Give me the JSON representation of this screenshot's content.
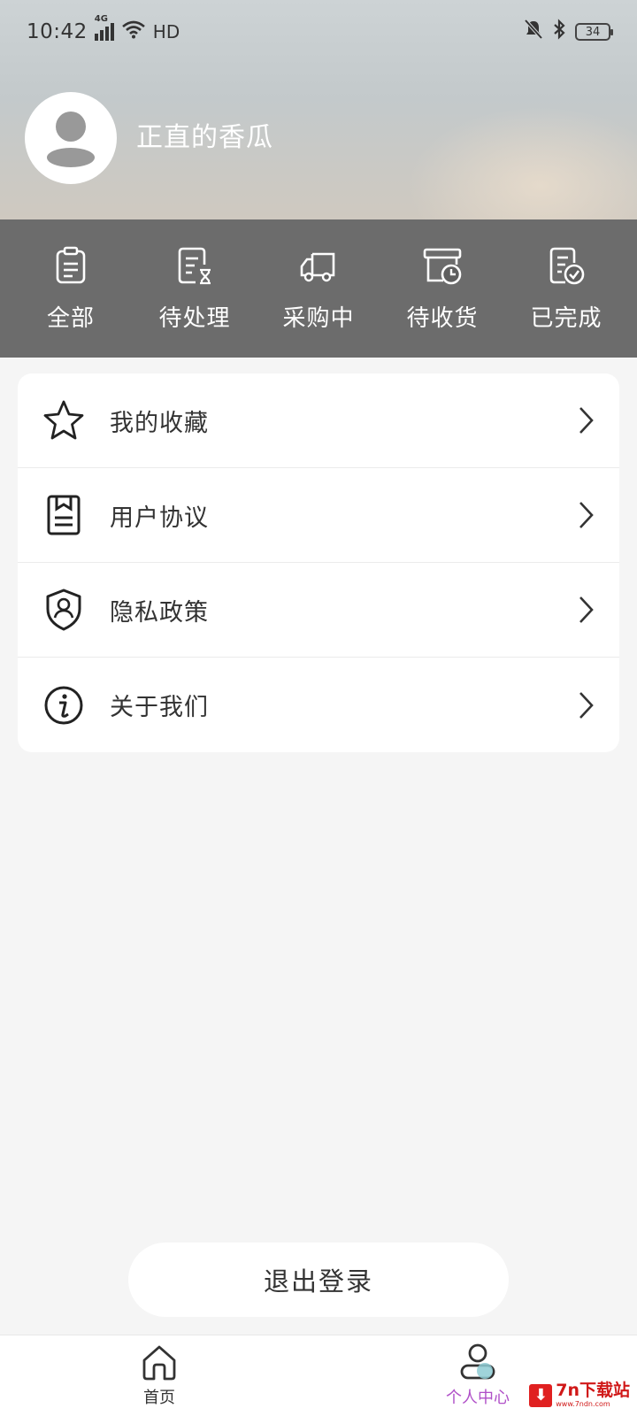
{
  "status_bar": {
    "time": "10:42",
    "network": "4G",
    "wifi_label": "HD",
    "battery": "34"
  },
  "profile": {
    "username": "正直的香瓜"
  },
  "orders": [
    {
      "label": "全部",
      "icon": "clipboard-icon"
    },
    {
      "label": "待处理",
      "icon": "pending-doc-icon"
    },
    {
      "label": "采购中",
      "icon": "truck-icon"
    },
    {
      "label": "待收货",
      "icon": "box-clock-icon"
    },
    {
      "label": "已完成",
      "icon": "doc-check-icon"
    }
  ],
  "menu": [
    {
      "label": "我的收藏",
      "icon": "star-icon"
    },
    {
      "label": "用户协议",
      "icon": "agreement-icon"
    },
    {
      "label": "隐私政策",
      "icon": "shield-user-icon"
    },
    {
      "label": "关于我们",
      "icon": "info-icon"
    }
  ],
  "logout_label": "退出登录",
  "tabs": [
    {
      "label": "首页",
      "icon": "home-icon",
      "active": false
    },
    {
      "label": "个人中心",
      "icon": "user-icon",
      "active": true
    }
  ],
  "watermark": {
    "main": "7n下载站",
    "sub": "www.7ndn.com"
  },
  "colors": {
    "active_tab": "#b050c8",
    "order_bar": "#5f5f5f",
    "page_bg": "#f5f5f5"
  }
}
